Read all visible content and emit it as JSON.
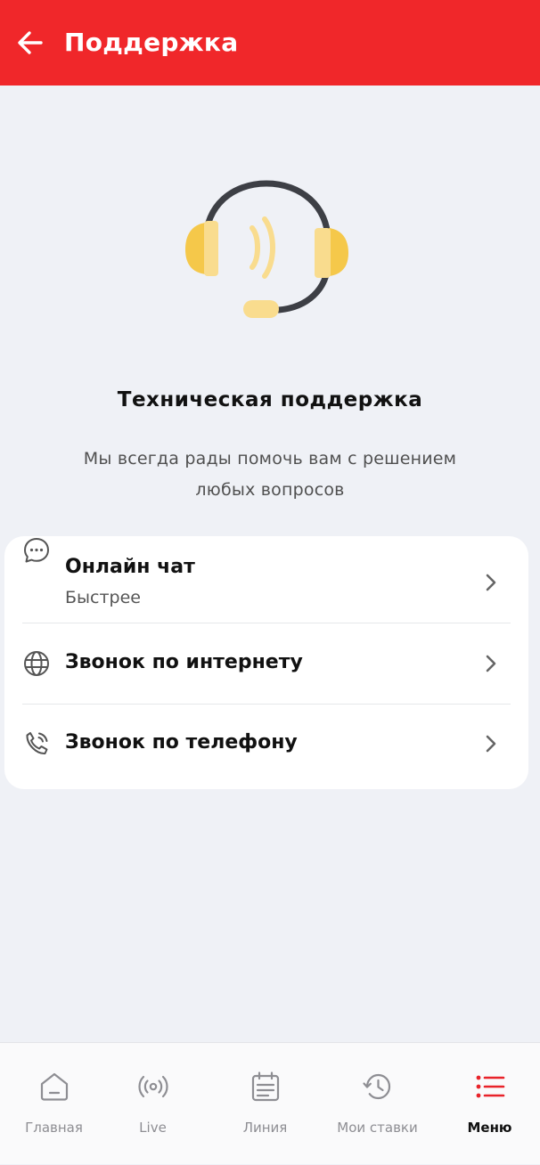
{
  "header": {
    "title": "Поддержка"
  },
  "hero": {
    "heading": "Техническая поддержка",
    "subtitle_line1": "Мы всегда рады помочь вам с решением",
    "subtitle_line2": "любых вопросов"
  },
  "options": [
    {
      "icon": "chat-bubble-icon",
      "label": "Онлайн чат",
      "sublabel": "Быстрее"
    },
    {
      "icon": "globe-icon",
      "label": "Звонок по интернету"
    },
    {
      "icon": "phone-call-icon",
      "label": "Звонок по телефону"
    }
  ],
  "bottom_nav": {
    "items": [
      {
        "icon": "home-icon",
        "label": "Главная"
      },
      {
        "icon": "live-broadcast-icon",
        "label": "Live"
      },
      {
        "icon": "calendar-list-icon",
        "label": "Линия"
      },
      {
        "icon": "history-icon",
        "label": "Мои ставки"
      },
      {
        "icon": "menu-list-icon",
        "label": "Меню"
      }
    ],
    "active_index": 4
  },
  "colors": {
    "brand_red": "#f0272a",
    "headset_yellow": "#f5c84a",
    "background": "#eff1f6"
  }
}
